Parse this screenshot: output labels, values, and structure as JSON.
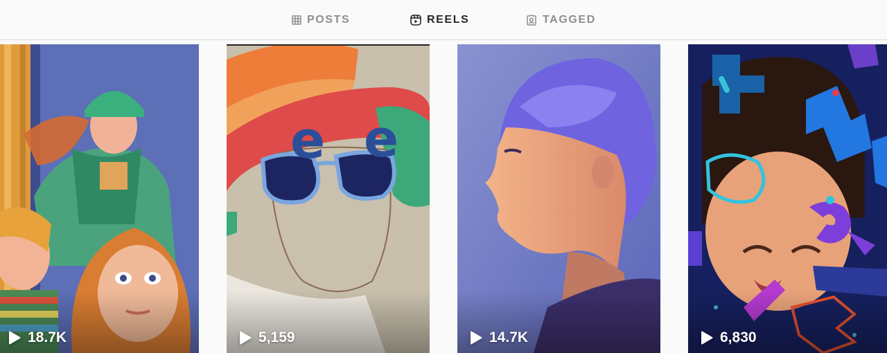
{
  "tabs": [
    {
      "label": "POSTS",
      "icon": "grid-icon",
      "active": false
    },
    {
      "label": "REELS",
      "icon": "reels-icon",
      "active": true
    },
    {
      "label": "TAGGED",
      "icon": "tagged-icon",
      "active": false
    }
  ],
  "reels": [
    {
      "views": "18.7K",
      "subject": "roller derby girls painting"
    },
    {
      "views": "5,159",
      "subject": "sunglasses portrait sketch"
    },
    {
      "views": "14.7K",
      "subject": "blue-haired profile painting"
    },
    {
      "views": "6,830",
      "subject": "child with letter shapes"
    }
  ],
  "colors": {
    "background": "#fafafa",
    "active_tab": "#262626",
    "inactive_tab": "#8e8e8e",
    "divider": "#dbdbdb"
  }
}
